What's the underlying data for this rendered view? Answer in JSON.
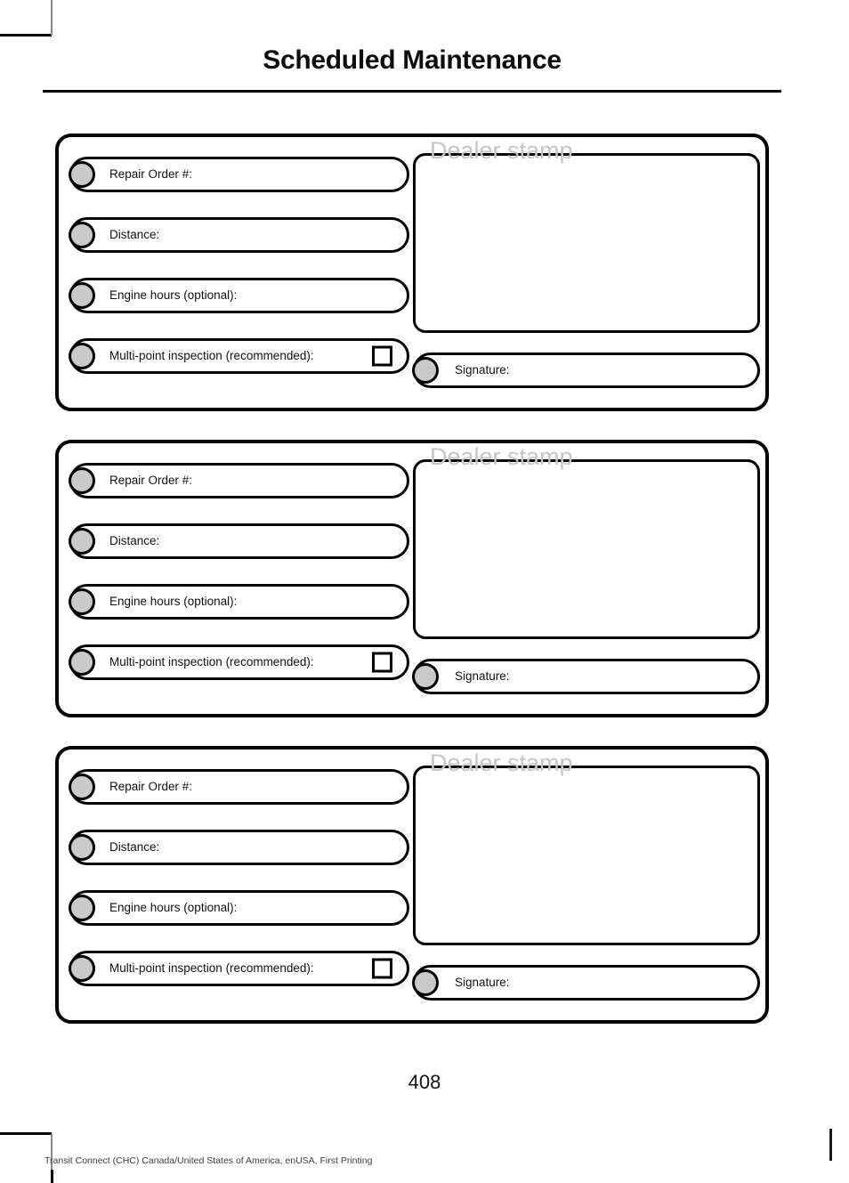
{
  "document": {
    "title": "Scheduled Maintenance",
    "page_number": "408",
    "footer": "Transit Connect (CHC) Canada/United States of America, enUSA, First Printing"
  },
  "colors": {
    "rule": "#000000",
    "dot_fill": "#c9c9c9",
    "stamp_text": "#c5c5c5",
    "text": "#111111"
  },
  "field_labels": {
    "repair_order": "Repair Order #:",
    "distance": "Distance:",
    "engine_hours": "Engine hours (optional):",
    "multi_point": "Multi-point inspection (recommended):",
    "dealer_stamp": "Dealer stamp",
    "signature": "Signature:"
  },
  "records": [
    {
      "repair_order": "Repair Order #:",
      "distance": "Distance:",
      "engine_hours": "Engine hours (optional):",
      "multi_point": "Multi-point inspection (recommended):",
      "dealer_stamp": "Dealer stamp",
      "signature": "Signature:"
    },
    {
      "repair_order": "Repair Order #:",
      "distance": "Distance:",
      "engine_hours": "Engine hours (optional):",
      "multi_point": "Multi-point inspection (recommended):",
      "dealer_stamp": "Dealer stamp",
      "signature": "Signature:"
    },
    {
      "repair_order": "Repair Order #:",
      "distance": "Distance:",
      "engine_hours": "Engine hours (optional):",
      "multi_point": "Multi-point inspection (recommended):",
      "dealer_stamp": "Dealer stamp",
      "signature": "Signature:"
    }
  ]
}
